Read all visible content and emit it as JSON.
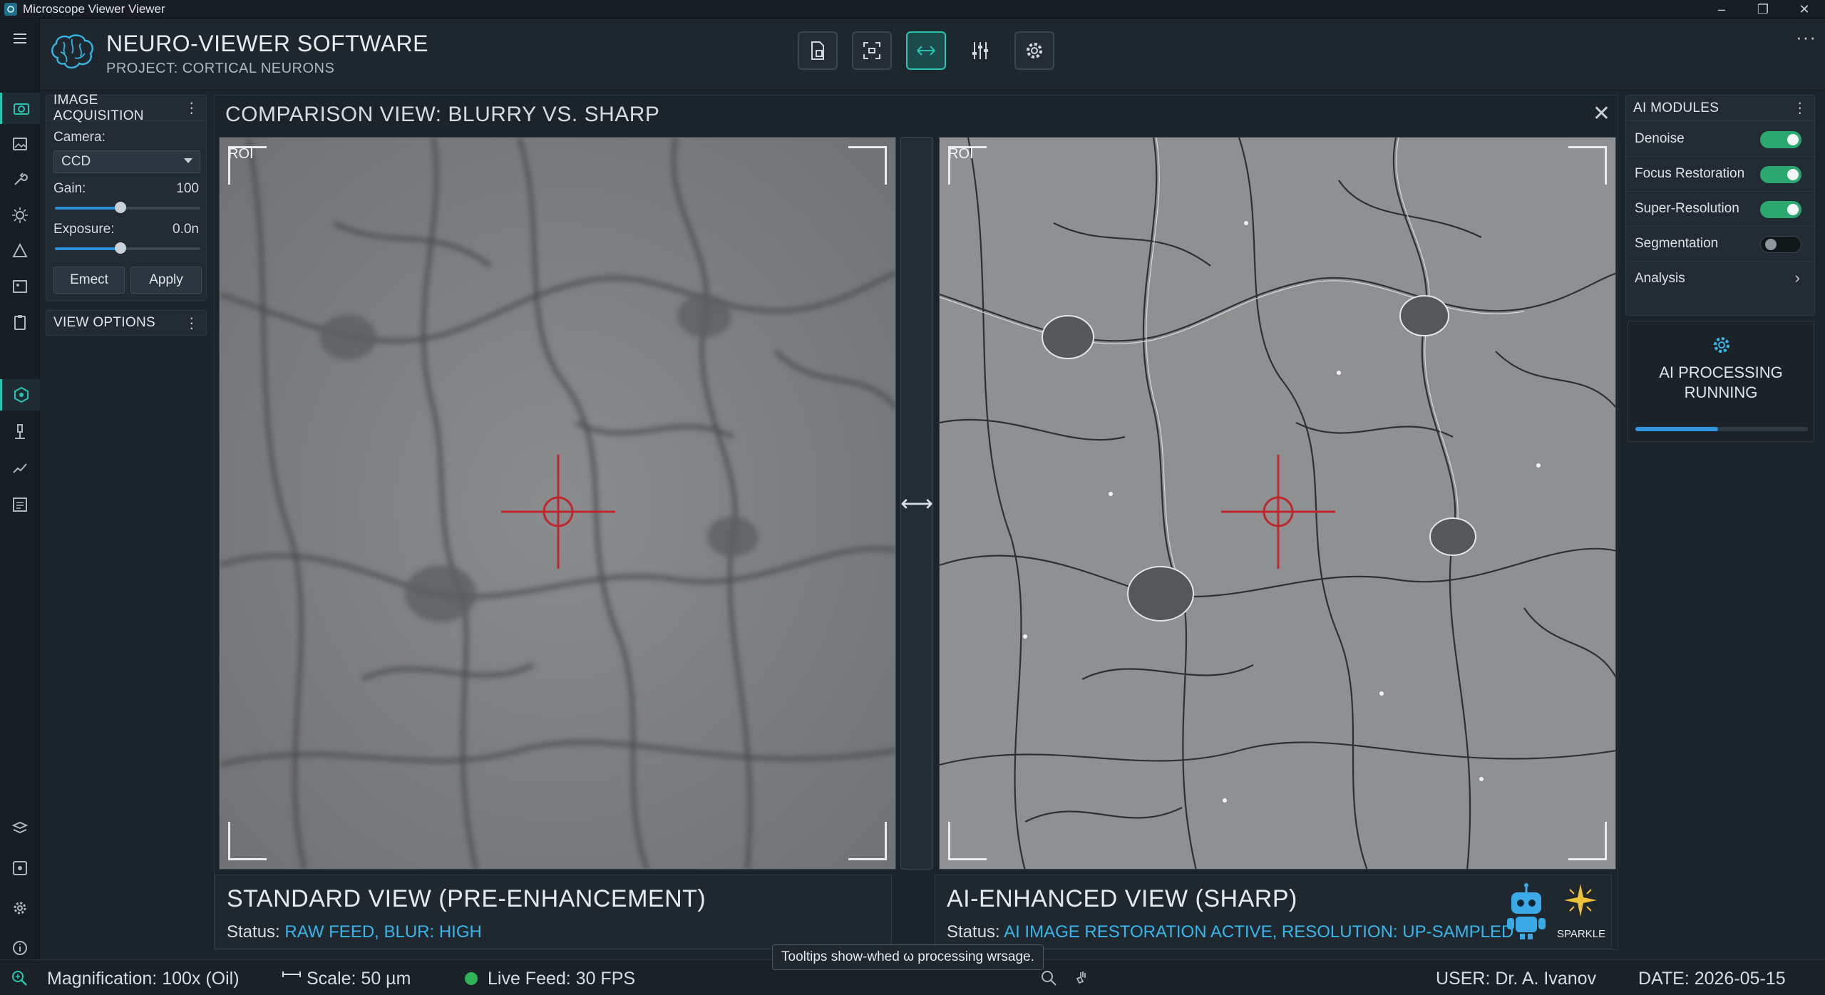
{
  "window": {
    "title": "Microscope Viewer Viewer",
    "controls": [
      "–",
      "❐",
      "✕"
    ]
  },
  "header": {
    "app_name": "NEURO-VIEWER SOFTWARE",
    "project": "PROJECT: CORTICAL NEURONS",
    "more": "···"
  },
  "acquisition": {
    "title": "IMAGE ACQUISITION",
    "camera_label": "Camera:",
    "camera_value": "CCD",
    "gain_label": "Gain:",
    "gain_value": "100",
    "gain_level": 0.45,
    "exposure_label": "Exposure:",
    "exposure_value": "0.0n",
    "exposure_level": 0.45,
    "eject_button": "Emect",
    "apply_button": "Apply"
  },
  "view_options": {
    "title": "VIEW OPTIONS"
  },
  "comparison": {
    "title": "COMPARISON VIEW: BLURRY VS. SHARP",
    "close": "✕",
    "roi_label": "ROI",
    "divider_icon": "⟷",
    "left": {
      "title": "STANDARD VIEW (PRE-ENHANCEMENT)",
      "status_prefix": "Status: ",
      "status_value": "RAW FEED, BLUR: HIGH"
    },
    "right": {
      "title": "AI-ENHANCED VIEW (SHARP)",
      "status_prefix": "Status: ",
      "status_value": "AI IMAGE RESTORATION ACTIVE, RESOLUTION: UP-SAMPLED",
      "sparkle_label": "SPARKLE"
    }
  },
  "ai_modules": {
    "title": "AI MODULES",
    "items": [
      {
        "label": "Denoise",
        "on": true
      },
      {
        "label": "Focus Restoration",
        "on": true
      },
      {
        "label": "Super-Resolution",
        "on": true
      },
      {
        "label": "Segmentation",
        "on": false
      }
    ],
    "analysis_label": "Analysis",
    "processing_line1": "AI PROCESSING",
    "processing_line2": "RUNNING",
    "progress": 0.48
  },
  "status_bar": {
    "magnification": "Magnification: 100x (Oil)",
    "scale": "Scale: 50 µm",
    "live_feed": "Live Feed: 30 FPS",
    "tooltip": "Tooltips show-whed ω processing wrsage.",
    "user": "USER: Dr. A. Ivanov",
    "date": "DATE: 2026-05-15"
  },
  "colors": {
    "accent": "#27c6b3",
    "status_highlight": "#36b6ea",
    "toggle_on": "#2aa86f",
    "crosshair": "#c0272d",
    "live": "#2fb457"
  },
  "icons": [
    "menu-icon",
    "camera-icon",
    "image-icon",
    "wrench-icon",
    "brightness-icon",
    "triangle-icon",
    "picture-icon",
    "clipboard-icon",
    "hexagon-icon",
    "microscope-icon",
    "chart-icon",
    "report-icon",
    "layers-icon",
    "screenshot-icon",
    "settings-icon",
    "info-icon",
    "zoom-icon"
  ]
}
